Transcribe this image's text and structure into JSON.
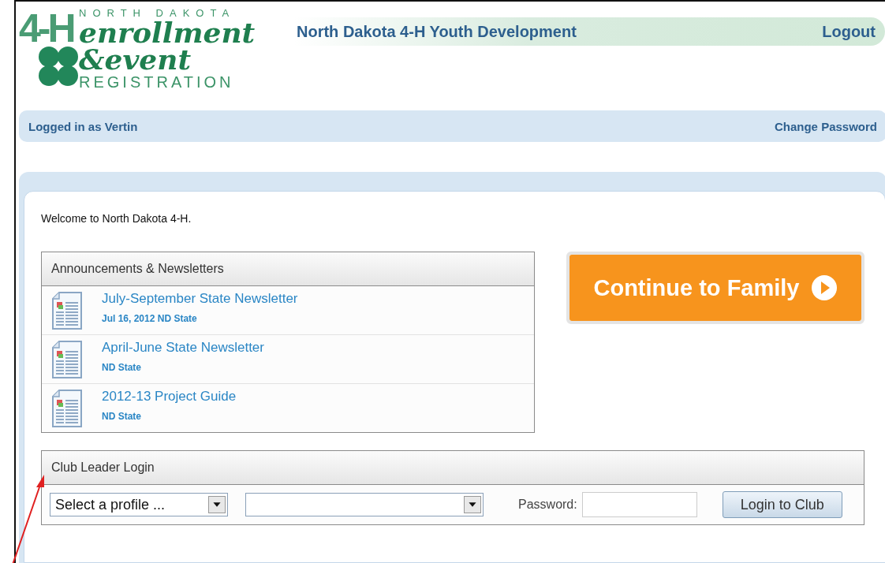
{
  "logo": {
    "mark": "4-H",
    "state": "NORTH DAKOTA",
    "line_1": "enrollment",
    "line_2": "&event",
    "line_3": "REGISTRATION"
  },
  "header": {
    "title": "North Dakota 4-H Youth Development",
    "logout": "Logout"
  },
  "user_bar": {
    "logged_in": "Logged in as Vertin",
    "change_password": "Change Password"
  },
  "welcome": "Welcome to North Dakota 4-H.",
  "announcements": {
    "title": "Announcements & Newsletters",
    "items": [
      {
        "title": "July-September State Newsletter",
        "meta": "Jul 16, 2012 ND State"
      },
      {
        "title": "April-June State Newsletter",
        "meta": "ND State"
      },
      {
        "title": "2012-13 Project Guide",
        "meta": "ND State"
      }
    ]
  },
  "continue_button": "Continue to Family",
  "club_login": {
    "title": "Club Leader Login",
    "profile_select": "Select a profile ...",
    "password_label": "Password:",
    "login_button": "Login to Club"
  }
}
